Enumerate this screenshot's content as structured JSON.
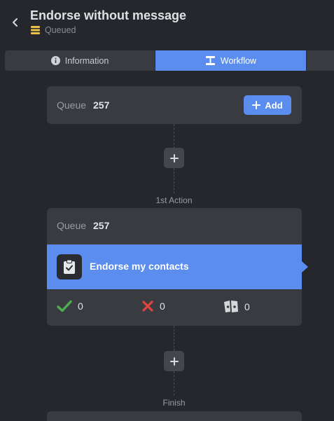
{
  "header": {
    "title": "Endorse without message",
    "status": "Queued",
    "status_color": "#e8c14a"
  },
  "tabs": [
    {
      "label": "Information",
      "icon": "info-circle-icon",
      "active": false
    },
    {
      "label": "Workflow",
      "icon": "workflow-icon",
      "active": true
    }
  ],
  "queue_card": {
    "label": "Queue",
    "count": "257",
    "add_label": "Add"
  },
  "actions_section": {
    "label": "1st Action"
  },
  "action_card": {
    "queue_label": "Queue",
    "queue_count": "257",
    "action_label": "Endorse my contacts",
    "action_icon": "clipboard-check-icon",
    "stats": [
      {
        "icon": "success-check-icon",
        "value": "0",
        "color": "#4cae4f"
      },
      {
        "icon": "failure-x-icon",
        "value": "0",
        "color": "#e0443e"
      },
      {
        "icon": "skipped-icon",
        "value": "0",
        "color": "#d6d7da"
      }
    ]
  },
  "finish_section": {
    "label": "Finish"
  },
  "colors": {
    "background": "#26272c",
    "card": "#3a3b41",
    "accent": "#5b8def"
  }
}
